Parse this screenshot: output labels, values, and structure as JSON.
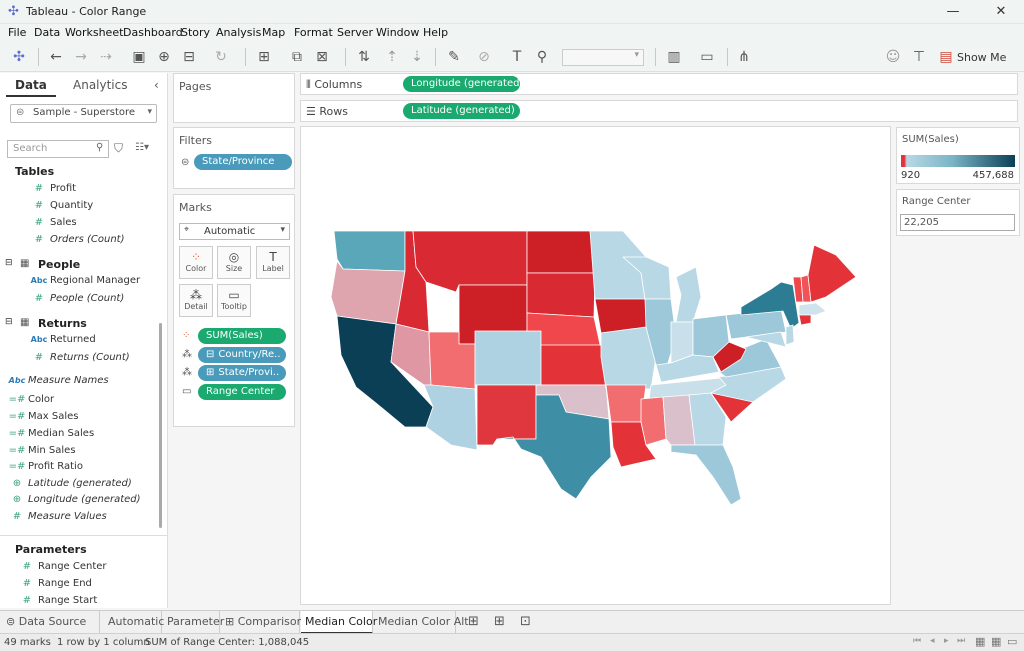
{
  "window": {
    "title": "Tableau - Color Range",
    "minimize": "—",
    "maximize": "☐",
    "close": "✕"
  },
  "menu": [
    "File",
    "Data",
    "Worksheet",
    "Dashboard",
    "Story",
    "Analysis",
    "Map",
    "Format",
    "Server",
    "Window",
    "Help"
  ],
  "toolbar": {
    "show_me": "Show Me"
  },
  "data_pane": {
    "tabs": [
      "Data",
      "Analytics"
    ],
    "datasource": "Sample - Superstore",
    "search_placeholder": "Search",
    "tables_header": "Tables",
    "tables_fields": [
      "Profit",
      "Quantity",
      "Sales",
      "Orders (Count)"
    ],
    "people_header": "People",
    "people_fields": [
      "Regional Manager",
      "People (Count)"
    ],
    "returns_header": "Returns",
    "returns_fields": [
      "Returned",
      "Returns (Count)"
    ],
    "other_fields": [
      "Measure Names",
      "Color",
      "Max Sales",
      "Median Sales",
      "Min Sales",
      "Profit Ratio",
      "Latitude (generated)",
      "Longitude (generated)",
      "Measure Values"
    ],
    "parameters_header": "Parameters",
    "parameters": [
      "Range Center",
      "Range End",
      "Range Start"
    ]
  },
  "cards": {
    "pages": "Pages",
    "filters": "Filters",
    "filter_pill": "State/Province",
    "marks": "Marks",
    "mark_type": "Automatic",
    "mark_buttons": [
      "Color",
      "Size",
      "Label",
      "Detail",
      "Tooltip"
    ],
    "mark_pills": [
      "SUM(Sales)",
      "Country/Re..",
      "State/Provi..",
      "Range Center"
    ]
  },
  "shelves": {
    "columns_label": "Columns",
    "columns_pill": "Longitude (generated)",
    "rows_label": "Rows",
    "rows_pill": "Latitude (generated)"
  },
  "legend": {
    "title": "SUM(Sales)",
    "min": "920",
    "max": "457,688",
    "colors": {
      "low": "#e8303a",
      "mid": "#b8d8e6",
      "high": "#0b3f55"
    }
  },
  "parameter_card": {
    "title": "Range Center",
    "value": "22,205"
  },
  "sheet_tabs": [
    "Data Source",
    "Automatic",
    "Parameter",
    "Comparison",
    "Median Color",
    "Median Color Alt"
  ],
  "active_tab": "Median Color",
  "status": {
    "marks": "49 marks",
    "dims": "1 row by 1 column",
    "sum": "SUM of Range Center: 1,088,045"
  }
}
